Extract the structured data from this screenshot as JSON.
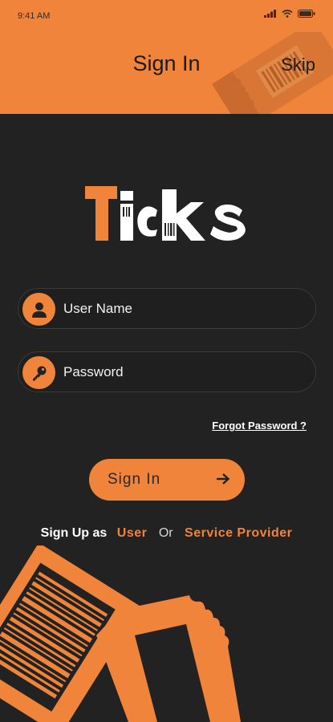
{
  "status_bar": {
    "time": "9:41 AM"
  },
  "header": {
    "title": "Sign In",
    "skip_label": "Skip"
  },
  "logo": {
    "text": "Ticks",
    "accent_letter": "T"
  },
  "form": {
    "username_placeholder": "User Name",
    "password_placeholder": "Password",
    "forgot_label": "Forgot Password ?",
    "signin_label": "Sign In"
  },
  "signup": {
    "prefix": "Sign Up as",
    "user_label": "User",
    "or_label": "Or",
    "provider_label": "Service Provider"
  },
  "colors": {
    "accent": "#F0843A",
    "background": "#222222"
  },
  "icons": [
    "user-icon",
    "key-icon",
    "arrow-right-icon",
    "signal-icon",
    "wifi-icon",
    "battery-icon"
  ]
}
